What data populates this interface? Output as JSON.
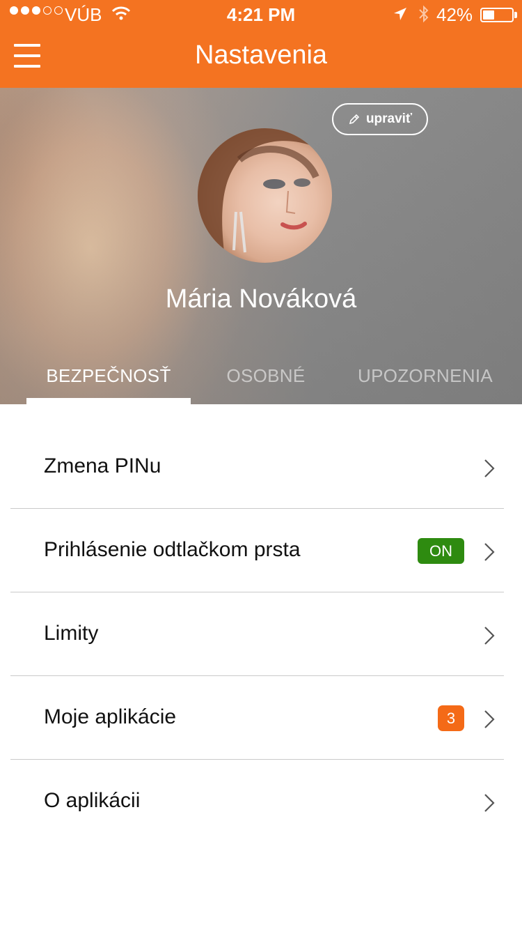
{
  "status_bar": {
    "carrier": "VÚB",
    "time": "4:21 PM",
    "battery": "42%"
  },
  "header": {
    "title": "Nastavenia",
    "menu_icon": "hamburger-menu-icon",
    "color": "#f47321"
  },
  "profile": {
    "edit_label": "upraviť",
    "edit_icon": "pencil-icon",
    "name": "Mária Nováková"
  },
  "tabs": [
    {
      "label": "BEZPEČNOSŤ",
      "active": true
    },
    {
      "label": "OSOBNÉ",
      "active": false
    },
    {
      "label": "UPOZORNENIA",
      "active": false
    }
  ],
  "settings": [
    {
      "label": "Zmena PINu"
    },
    {
      "label": "Prihlásenie odtlačkom prsta",
      "toggle": "ON",
      "toggle_color": "#2e8b10"
    },
    {
      "label": "Limity"
    },
    {
      "label": "Moje aplikácie",
      "badge": "3",
      "badge_color": "#f46a17"
    },
    {
      "label": "O aplikácii"
    }
  ]
}
